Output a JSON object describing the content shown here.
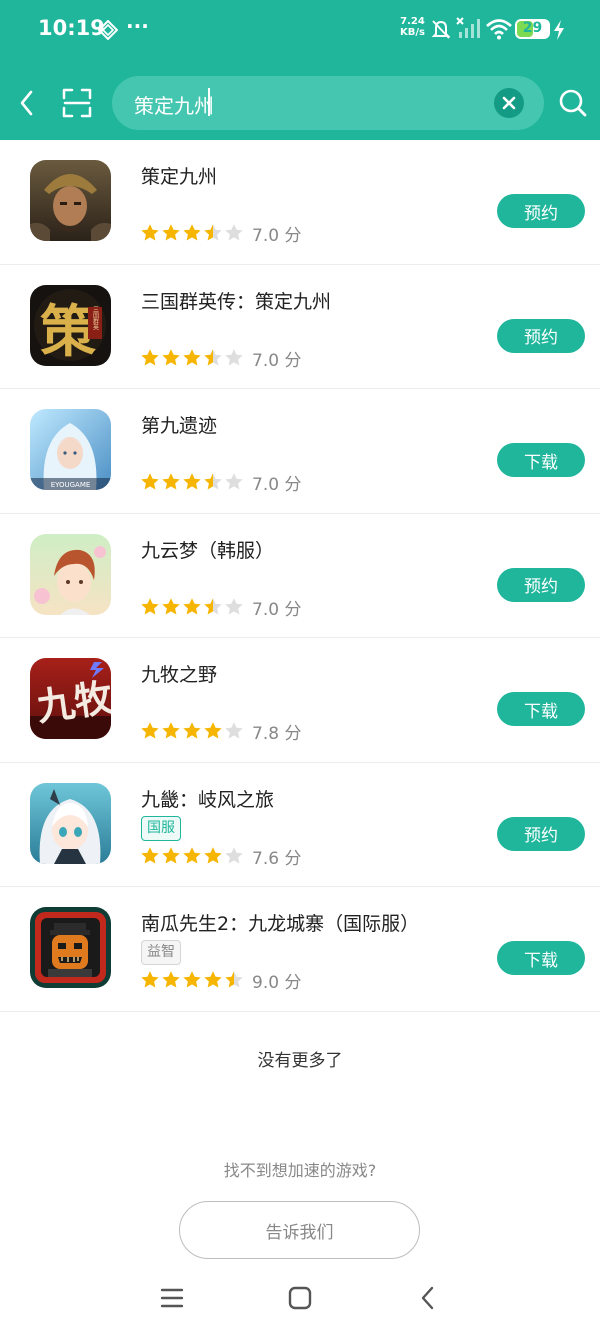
{
  "status_bar": {
    "time": "10:19",
    "more": "···",
    "speed_value": "7.24",
    "speed_unit": "KB/s",
    "battery": "29"
  },
  "search": {
    "query": "策定九州"
  },
  "results": [
    {
      "name": "策定九州",
      "tag": "",
      "rating": 3.5,
      "score": "7.0 分",
      "action": "预约"
    },
    {
      "name": "三国群英传：策定九州",
      "tag": "",
      "rating": 3.5,
      "score": "7.0 分",
      "action": "预约",
      "icon_text": "策",
      "icon_sub": "三国群英"
    },
    {
      "name": "第九遗迹",
      "tag": "",
      "rating": 3.5,
      "score": "7.0 分",
      "action": "下载",
      "icon_text": "EYOUGAME"
    },
    {
      "name": "九云梦（韩服）",
      "tag": "",
      "rating": 3.5,
      "score": "7.0 分",
      "action": "预约"
    },
    {
      "name": "九牧之野",
      "tag": "",
      "rating": 4,
      "score": "7.8 分",
      "action": "下载",
      "icon_text": "九牧"
    },
    {
      "name": "九畿：岐风之旅",
      "tag": "国服",
      "rating": 4,
      "score": "7.6 分",
      "action": "预约"
    },
    {
      "name": "南瓜先生2：九龙城寨（国际服）",
      "tag": "益智",
      "rating": 4.5,
      "score": "9.0 分",
      "action": "下载"
    }
  ],
  "footer": {
    "no_more": "没有更多了",
    "hint": "找不到想加速的游戏?",
    "tell_us": "告诉我们"
  },
  "colors": {
    "brand": "#1fb69c",
    "star": "#f6b500",
    "star_empty": "#dedede"
  }
}
